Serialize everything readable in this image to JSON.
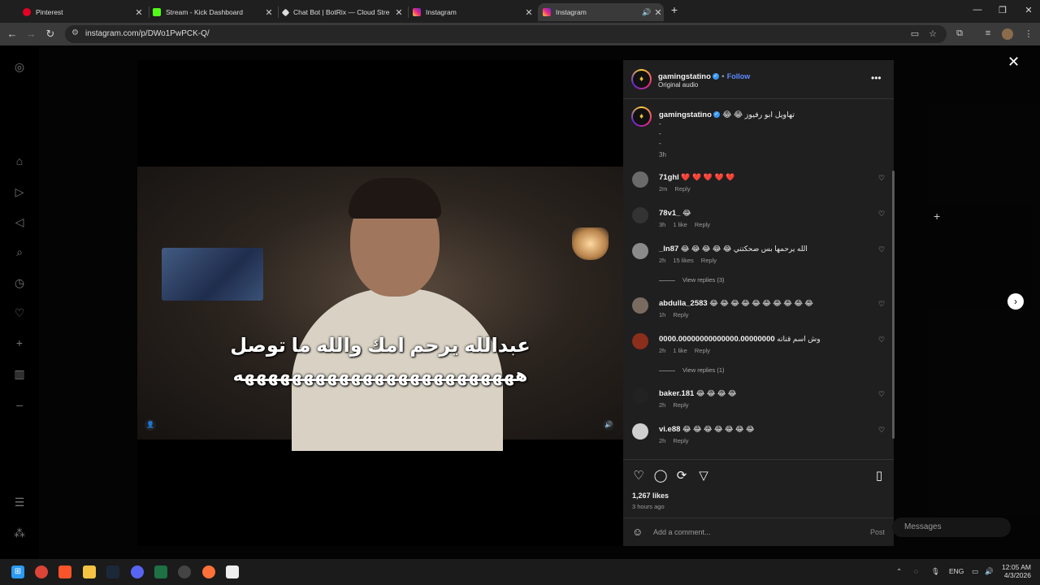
{
  "browser": {
    "tabs": [
      {
        "label": "Pinterest",
        "color": "#e60023"
      },
      {
        "label": "Stream - Kick Dashboard",
        "color": "#53fc18"
      },
      {
        "label": "Chat Bot | BotRix — Cloud Stre",
        "color": "#dddddd"
      },
      {
        "label": "Instagram",
        "color": "#e1306c"
      },
      {
        "label": "Instagram",
        "color": "#e1306c",
        "active": true
      }
    ],
    "url": "instagram.com/p/DWo1PwPCK-Q/"
  },
  "video": {
    "subtitle_line1": "عبدالله يرحم امك والله ما توصل",
    "subtitle_line2": "ههههههههههههههههههههههههه"
  },
  "post": {
    "author": "gamingstatino",
    "follow_label": "Follow",
    "audio": "Original audio",
    "caption_user": "gamingstatino",
    "caption_text": "😂 😂 تهاويل ابو رفيوز",
    "caption_dashes": [
      "-",
      "-",
      "-"
    ],
    "caption_time": "3h",
    "likes": "1,267 likes",
    "posted": "3 hours ago",
    "add_comment_placeholder": "Add a comment...",
    "post_label": "Post",
    "messages_label": "Messages"
  },
  "comments": [
    {
      "user": "71ghl",
      "text": "❤️ ❤️ ❤️ ❤️ ❤️",
      "time": "2m",
      "likes": "",
      "reply": "Reply",
      "avatar": "#6a6a6a"
    },
    {
      "user": "78v1_",
      "text": "😂",
      "time": "3h",
      "likes": "1 like",
      "reply": "Reply",
      "avatar": "#333333"
    },
    {
      "user": "_ln87",
      "text": "😂 😂 😂 😂 😂 الله يرحمها بس ضحكتني",
      "time": "2h",
      "likes": "15 likes",
      "reply": "Reply",
      "avatar": "#8a8a8a",
      "view_replies": "View replies (3)"
    },
    {
      "user": "abdulla_2583",
      "text": "😂 😂 😂 😂 😂 😂 😂 😂 😂 😂",
      "time": "1h",
      "likes": "",
      "reply": "Reply",
      "avatar": "#7a6b60"
    },
    {
      "user": "0000.00000000000000.00000000",
      "text": "وش اسم قناته",
      "time": "2h",
      "likes": "1 like",
      "reply": "Reply",
      "avatar": "#8b2e1c",
      "view_replies": "View replies (1)"
    },
    {
      "user": "baker.181",
      "text": "😂 😂 😂 😂",
      "time": "2h",
      "likes": "",
      "reply": "Reply",
      "avatar": "#222222"
    },
    {
      "user": "vi.e88",
      "text": "😂 😂 😂 😂 😂 😂 😂",
      "time": "2h",
      "likes": "",
      "reply": "Reply",
      "avatar": "#cfcfcf"
    }
  ],
  "taskbar": {
    "lang": "ENG",
    "time": "12:05 AM",
    "date": "4/3/2026"
  }
}
